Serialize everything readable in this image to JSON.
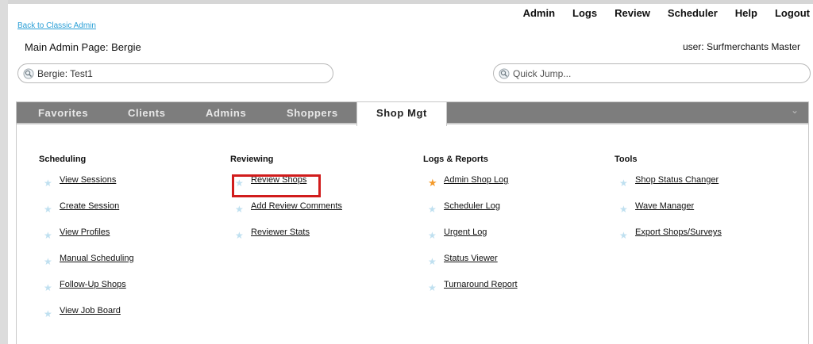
{
  "topnav": [
    "Admin",
    "Logs",
    "Review",
    "Scheduler",
    "Help",
    "Logout"
  ],
  "back_link": "Back to Classic Admin",
  "main_title": "Main Admin Page: Bergie",
  "user_label": "user: Surfmerchants Master",
  "client_search": {
    "value": "Bergie: Test1"
  },
  "quick_jump": {
    "placeholder": "Quick Jump..."
  },
  "tabs": [
    "Favorites",
    "Clients",
    "Admins",
    "Shoppers",
    "Shop Mgt"
  ],
  "active_tab": "Shop Mgt",
  "colors": {
    "tabbar": "#7d7d7d",
    "link_blue": "#2a9fd6",
    "star_default": "#bfe0f0",
    "star_favorite": "#f39a2b",
    "highlight": "#d11c1c"
  },
  "columns": [
    {
      "heading": "Scheduling",
      "items": [
        {
          "label": "View Sessions",
          "favorite": false
        },
        {
          "label": "Create Session",
          "favorite": false
        },
        {
          "label": "View Profiles",
          "favorite": false
        },
        {
          "label": "Manual Scheduling",
          "favorite": false
        },
        {
          "label": "Follow-Up Shops",
          "favorite": false
        },
        {
          "label": "View Job Board",
          "favorite": false
        }
      ]
    },
    {
      "heading": "Reviewing",
      "items": [
        {
          "label": "Review Shops",
          "favorite": false,
          "highlighted": true
        },
        {
          "label": "Add Review Comments",
          "favorite": false
        },
        {
          "label": "Reviewer Stats",
          "favorite": false
        }
      ]
    },
    {
      "heading": "Logs & Reports",
      "items": [
        {
          "label": "Admin Shop Log",
          "favorite": true
        },
        {
          "label": "Scheduler Log",
          "favorite": false
        },
        {
          "label": "Urgent Log",
          "favorite": false
        },
        {
          "label": "Status Viewer",
          "favorite": false
        },
        {
          "label": "Turnaround Report",
          "favorite": false
        }
      ]
    },
    {
      "heading": "Tools",
      "items": [
        {
          "label": "Shop Status Changer",
          "favorite": false
        },
        {
          "label": "Wave Manager",
          "favorite": false
        },
        {
          "label": "Export Shops/Surveys",
          "favorite": false
        }
      ]
    }
  ]
}
